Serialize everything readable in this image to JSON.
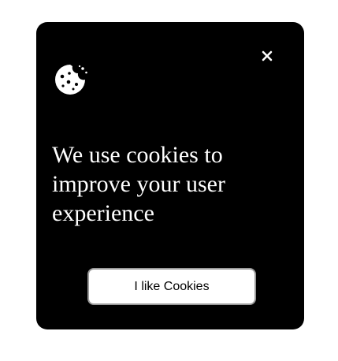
{
  "modal": {
    "icon": "cookie-icon",
    "message": "We use cookies to improve your user experience",
    "close_icon": "close-icon",
    "accept_label": "I like Cookies",
    "colors": {
      "background": "#000000",
      "text": "#ffffff",
      "button_background": "#ffffff",
      "button_text": "#000000"
    }
  }
}
